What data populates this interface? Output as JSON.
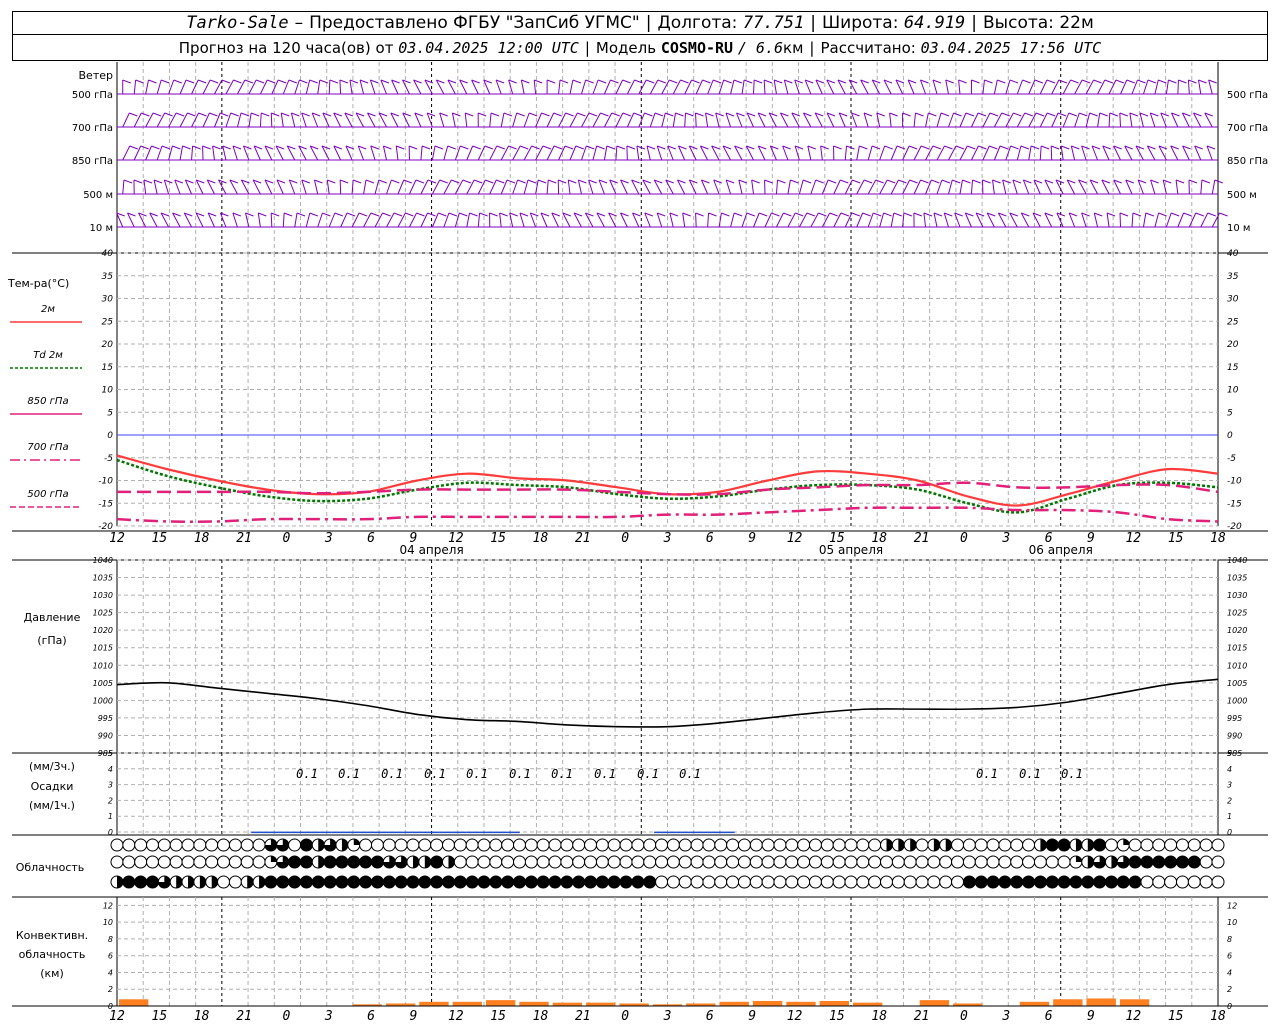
{
  "header": {
    "station": "Tarko-Sale",
    "dash": "–",
    "provider": "Предоставлено ФГБУ \"ЗапСиб УГМС\"",
    "lon_label": "Долгота:",
    "lon_value": "77.751",
    "lat_label": "Широта:",
    "lat_value": "64.919",
    "alt_label": "Высота:",
    "alt_value": "22м",
    "forecast_prefix": "Прогноз на 120 часа(ов) от",
    "forecast_time": "03.04.2025 12:00 UTC",
    "model_label": "Модель",
    "model_name": "COSMO-RU",
    "model_res": "/ 6.6",
    "model_unit": "км",
    "calc_label": "Рассчитано:",
    "calc_time": "03.04.2025 17:56 UTC"
  },
  "colors": {
    "t2m": "#ff3b3b",
    "td2m": "#007700",
    "t850": "#e0207a",
    "t700": "#e0207a",
    "t500": "#e0207a",
    "wind": "#8000c0",
    "pressure": "#000000",
    "precip": "#2050d0",
    "convective": "#ff8020",
    "grid": "#b0b0b0",
    "zero_line": "#4040ff"
  },
  "time_axis": {
    "hour_labels": [
      "12",
      "15",
      "18",
      "21",
      "0",
      "3",
      "6",
      "9",
      "12",
      "15",
      "18",
      "21",
      "0",
      "3",
      "6",
      "9",
      "12",
      "15",
      "18",
      "21",
      "0",
      "3",
      "6",
      "9",
      "12",
      "15",
      "18"
    ],
    "date_labels": [
      "04 апреля",
      "05 апреля",
      "06 апреля"
    ]
  },
  "wind_panel": {
    "title": "Ветер",
    "levels": [
      "500 гПа",
      "700 гПа",
      "850 гПа",
      "500  м",
      "10   м"
    ],
    "right_levels": [
      "500 гПа",
      "700 гПа",
      "850 гПа",
      "500  м",
      "10   м"
    ]
  },
  "temp_panel": {
    "title": "Тем-ра(°С)",
    "legend": [
      {
        "label": "2м"
      },
      {
        "label_it": "Td",
        "label": "2м"
      },
      {
        "label": "850 гПа"
      },
      {
        "label": "700 гПа"
      },
      {
        "label": "500 гПа"
      }
    ]
  },
  "pressure_panel": {
    "title1": "Давление",
    "title2": "(гПа)"
  },
  "precip_panel": {
    "title1": "(мм/3ч.)",
    "title2": "Осадки",
    "title3": "(мм/1ч.)",
    "labels": [
      "0.1",
      "0.1",
      "0.1",
      "0.1",
      "0.1",
      "0.1",
      "0.1",
      "0.1",
      "0.1",
      "0.1",
      "0.1",
      "0.1",
      "0.1"
    ]
  },
  "cloud_panel": {
    "title": "Облачность"
  },
  "convective_panel": {
    "title1": "Конвективн.",
    "title2": "облачность",
    "title3": "(км)"
  },
  "chart_data": [
    {
      "type": "line",
      "title": "Тем-ра(°С)",
      "ylabel": "Тем-ра(°С)",
      "ylim": [
        -20,
        40
      ],
      "y_ticks": [
        40,
        35,
        30,
        25,
        20,
        15,
        10,
        5,
        0,
        -5,
        -10,
        -15,
        -20
      ],
      "x": [
        0,
        6,
        12,
        18,
        24,
        30,
        36,
        42,
        48,
        54,
        60,
        66,
        72,
        78,
        84,
        90,
        96,
        102,
        108,
        114,
        120,
        126
      ],
      "x_note": "hours from 03.04.2025 12:00 UTC",
      "series": [
        {
          "name": "2м",
          "values": [
            -4.5,
            -7.5,
            -10,
            -12,
            -13,
            -12.5,
            -10,
            -8.5,
            -9.5,
            -10,
            -11.5,
            -13,
            -12.5,
            -10,
            -8,
            -8.5,
            -10,
            -13.5,
            -15.5,
            -13,
            -10,
            -7.5,
            -8.5
          ]
        },
        {
          "name": "Td 2м",
          "values": [
            -5.5,
            -9,
            -11.5,
            -13.5,
            -14.5,
            -14,
            -12,
            -10.5,
            -11,
            -11.5,
            -13,
            -14,
            -13.5,
            -12,
            -11,
            -11,
            -12,
            -15,
            -17,
            -14,
            -11,
            -10.5,
            -11.5
          ]
        },
        {
          "name": "850 гПа",
          "values": [
            -12.5,
            -12.5,
            -12.5,
            -12.5,
            -12.8,
            -12.5,
            -12,
            -12,
            -12,
            -12,
            -12.5,
            -13,
            -13,
            -12,
            -11.5,
            -11,
            -11,
            -10.5,
            -11.5,
            -11.5,
            -11,
            -11,
            -12.5
          ]
        },
        {
          "name": "700 гПа",
          "values": [
            -18.5,
            -19,
            -19,
            -18.5,
            -18.5,
            -18.5,
            -18,
            -18,
            -18,
            -18,
            -18,
            -17.5,
            -17.5,
            -17,
            -16.5,
            -16,
            -16,
            -16,
            -16.5,
            -16.5,
            -17,
            -18.5,
            -19
          ]
        },
        {
          "name": "500 гПа",
          "values": []
        }
      ]
    },
    {
      "type": "line",
      "title": "Давление",
      "ylabel": "(гПа)",
      "ylim": [
        985,
        1040
      ],
      "y_ticks": [
        1040,
        1035,
        1030,
        1025,
        1020,
        1015,
        1010,
        1005,
        1000,
        995,
        990,
        985
      ],
      "x": [
        0,
        6,
        12,
        18,
        24,
        30,
        36,
        42,
        48,
        54,
        60,
        66,
        72,
        78,
        84,
        90,
        96,
        102,
        108,
        114,
        120
      ],
      "series": [
        {
          "name": "",
          "values": [
            1004.5,
            1005,
            1003.5,
            1002,
            1000.5,
            998.5,
            996,
            994.5,
            994,
            993,
            992.5,
            992.5,
            993.5,
            995,
            996.5,
            997.5,
            997.5,
            997.5,
            998,
            999.5,
            1002,
            1004.5,
            1006
          ]
        }
      ]
    },
    {
      "type": "bar",
      "title": "Осадки",
      "ylabel": "(мм/3ч.)",
      "ylim": [
        0,
        5
      ],
      "y_ticks": [
        5,
        4,
        3,
        2,
        1,
        0
      ],
      "series": [
        {
          "name": "",
          "values": [
            0,
            0,
            0,
            0,
            0,
            0.1,
            0.1,
            0.1,
            0.1,
            0.1,
            0.1,
            0.1,
            0.1,
            0.1,
            0.1,
            0,
            0,
            0,
            0,
            0,
            0.1,
            0.1,
            0.1,
            0,
            0,
            0,
            0,
            0,
            0,
            0,
            0,
            0,
            0,
            0,
            0,
            0,
            0,
            0,
            0,
            0,
            0
          ]
        }
      ]
    },
    {
      "type": "bar",
      "title": "Конвективн. облачность",
      "ylabel": "(км)",
      "ylim": [
        0,
        13
      ],
      "y_ticks": [
        12,
        10,
        8,
        6,
        4,
        2,
        0
      ],
      "series": [
        {
          "name": "",
          "values": [
            0.8,
            0,
            0,
            0,
            0,
            0,
            0,
            0.2,
            0.3,
            0.5,
            0.5,
            0.7,
            0.5,
            0.4,
            0.4,
            0.3,
            0.2,
            0.3,
            0.5,
            0.6,
            0.5,
            0.6,
            0.4,
            0,
            0.7,
            0.3,
            0,
            0.5,
            0.8,
            0.9,
            0.8,
            0,
            0
          ]
        }
      ]
    }
  ],
  "clouds": {
    "rows": [
      "0000000000000330423210000000000000000000000000000000000000000000022202200000002442240100000000",
      "0000000000000134424444433224200000000000000000000000000000000000000000000000000001232344444400",
      "2444322220022444444444444444444444444444444444000000000000000000000000004444444444444440000000"
    ]
  }
}
